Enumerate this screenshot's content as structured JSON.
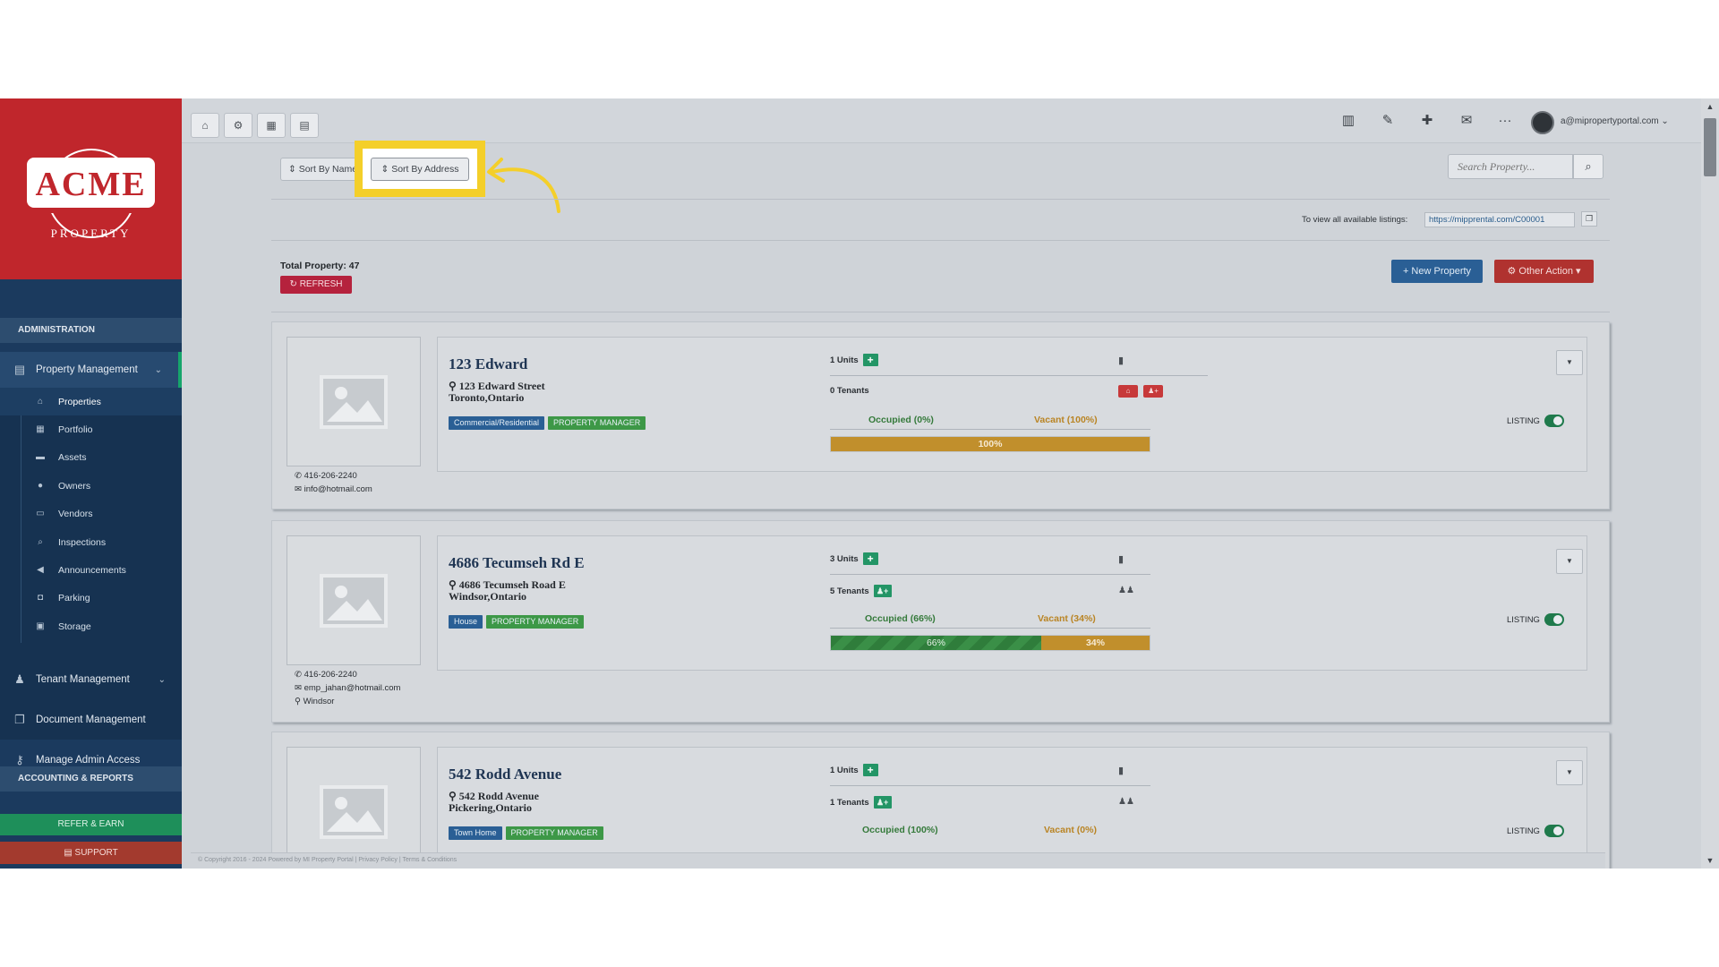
{
  "sidebar": {
    "logo_text": "ACME",
    "logo_sub": "PROPERTY",
    "admin_header": "ADMINISTRATION",
    "property_management": "Property Management",
    "sub_items": [
      {
        "label": "Properties",
        "icon": "home-icon"
      },
      {
        "label": "Portfolio",
        "icon": "portfolio-icon"
      },
      {
        "label": "Assets",
        "icon": "assets-icon"
      },
      {
        "label": "Owners",
        "icon": "owner-icon"
      },
      {
        "label": "Vendors",
        "icon": "vendor-icon"
      },
      {
        "label": "Inspections",
        "icon": "search-icon"
      },
      {
        "label": "Announcements",
        "icon": "bullhorn-icon"
      },
      {
        "label": "Parking",
        "icon": "car-icon"
      },
      {
        "label": "Storage",
        "icon": "storage-icon"
      }
    ],
    "tenant_management": "Tenant Management",
    "document_management": "Document Management",
    "manage_admin_access": "Manage Admin Access",
    "accounting_header": "ACCOUNTING & REPORTS",
    "refer_earn": "REFER & EARN",
    "support": "SUPPORT"
  },
  "topbar": {
    "user_email": "a@mipropertyportal.com",
    "more": "···"
  },
  "toolbar": {
    "sort_by_name": "⇕ Sort By Name",
    "sort_by_address": "⇕ Sort By Address",
    "search_placeholder": "Search Property..."
  },
  "listing_info": {
    "label": "To view all available listings:",
    "url": "https://mipprental.com/C00001"
  },
  "summary": {
    "total_property": "Total Property: 47",
    "refresh": "REFRESH",
    "new_property": "+ New Property",
    "other_action": "⚙ Other Action ▾"
  },
  "properties": [
    {
      "name": "123 Edward",
      "street": "123 Edward Street",
      "city": "Toronto,Ontario",
      "type_tag": "Commercial/Residential",
      "pm_tag": "PROPERTY MANAGER",
      "units": "1 Units",
      "tenants": "0 Tenants",
      "occupied": "Occupied (0%)",
      "vacant": "Vacant (100%)",
      "occupied_pct": 0,
      "vacant_pct": 100,
      "bar_vac_label": "100%",
      "phone": "416-206-2240",
      "email": "info@hotmail.com",
      "location": "",
      "listing": "LISTING"
    },
    {
      "name": "4686 Tecumseh Rd E",
      "street": "4686 Tecumseh Road E",
      "city": "Windsor,Ontario",
      "type_tag": "House",
      "pm_tag": "PROPERTY MANAGER",
      "units": "3 Units",
      "tenants": "5 Tenants",
      "occupied": "Occupied (66%)",
      "vacant": "Vacant (34%)",
      "occupied_pct": 66,
      "vacant_pct": 34,
      "bar_occ_label": "66%",
      "bar_vac_label": "34%",
      "phone": "416-206-2240",
      "email": "emp_jahan@hotmail.com",
      "location": "Windsor",
      "listing": "LISTING"
    },
    {
      "name": "542 Rodd Avenue",
      "street": "542 Rodd Avenue",
      "city": "Pickering,Ontario",
      "type_tag": "Town Home",
      "pm_tag": "PROPERTY MANAGER",
      "units": "1 Units",
      "tenants": "1 Tenants",
      "occupied": "Occupied (100%)",
      "vacant": "Vacant (0%)",
      "listing": "LISTING"
    }
  ],
  "footer": "© Copyright 2016 - 2024 Powered by MI Property Portal | Privacy Policy | Terms & Conditions",
  "colors": {
    "brand_red": "#c0262c",
    "sidebar_navy": "#1b3a5e",
    "highlight_yellow": "#f4cf2a",
    "accent_green": "#239566"
  }
}
